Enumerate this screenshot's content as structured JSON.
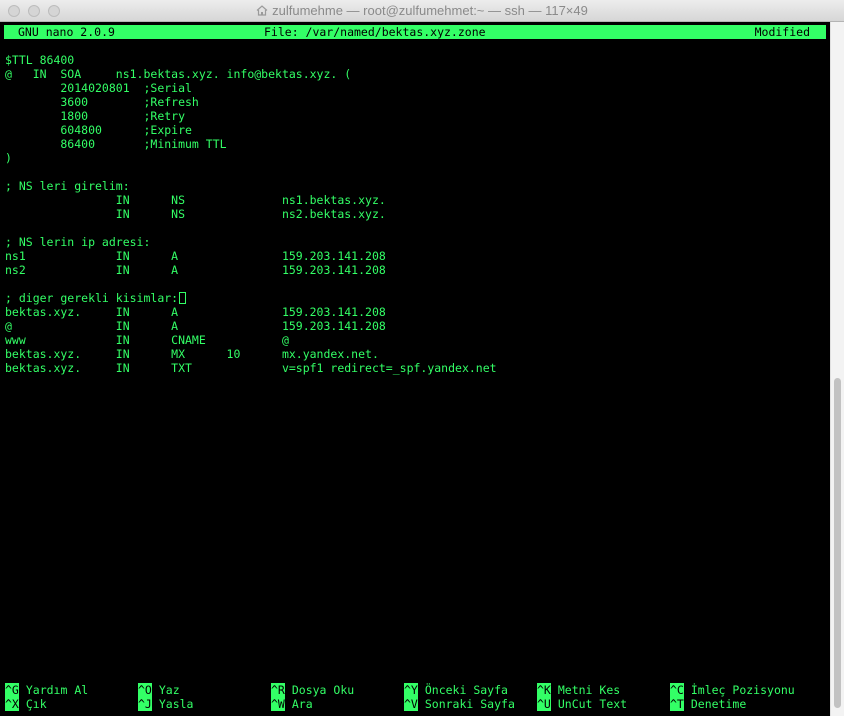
{
  "window": {
    "title": "zulfumehme — root@zulfumehmet:~ — ssh — 117×49",
    "icon": "home-icon"
  },
  "header": {
    "app": "GNU nano 2.0.9",
    "file": "File: /var/named/bektas.xyz.zone",
    "status": "Modified"
  },
  "editor": {
    "lines": [
      "$TTL 86400",
      "@   IN  SOA     ns1.bektas.xyz. info@bektas.xyz. (",
      "        2014020801  ;Serial",
      "        3600        ;Refresh",
      "        1800        ;Retry",
      "        604800      ;Expire",
      "        86400       ;Minimum TTL",
      ")",
      "",
      "; NS leri girelim:",
      "                IN      NS              ns1.bektas.xyz.",
      "                IN      NS              ns2.bektas.xyz.",
      "",
      "; NS lerin ip adresi:",
      "ns1             IN      A               159.203.141.208",
      "ns2             IN      A               159.203.141.208",
      "",
      "; diger gerekli kisimlar:",
      "bektas.xyz.     IN      A               159.203.141.208",
      "@               IN      A               159.203.141.208",
      "www             IN      CNAME           @",
      "bektas.xyz.     IN      MX      10      mx.yandex.net.",
      "bektas.xyz.     IN      TXT             v=spf1 redirect=_spf.yandex.net"
    ]
  },
  "shortcuts": [
    {
      "key": "^G",
      "label": "Yardım Al"
    },
    {
      "key": "^O",
      "label": "Yaz"
    },
    {
      "key": "^R",
      "label": "Dosya Oku"
    },
    {
      "key": "^Y",
      "label": "Önceki Sayfa"
    },
    {
      "key": "^K",
      "label": "Metni Kes"
    },
    {
      "key": "^C",
      "label": "İmleç Pozisyonu"
    },
    {
      "key": "^X",
      "label": "Çık"
    },
    {
      "key": "^J",
      "label": "Yasla"
    },
    {
      "key": "^W",
      "label": "Ara"
    },
    {
      "key": "^V",
      "label": "Sonraki Sayfa"
    },
    {
      "key": "^U",
      "label": "UnCut Text"
    },
    {
      "key": "^T",
      "label": "Denetime"
    }
  ],
  "colors": {
    "terminal_fg": "#33ff66",
    "terminal_bg": "#000000"
  }
}
